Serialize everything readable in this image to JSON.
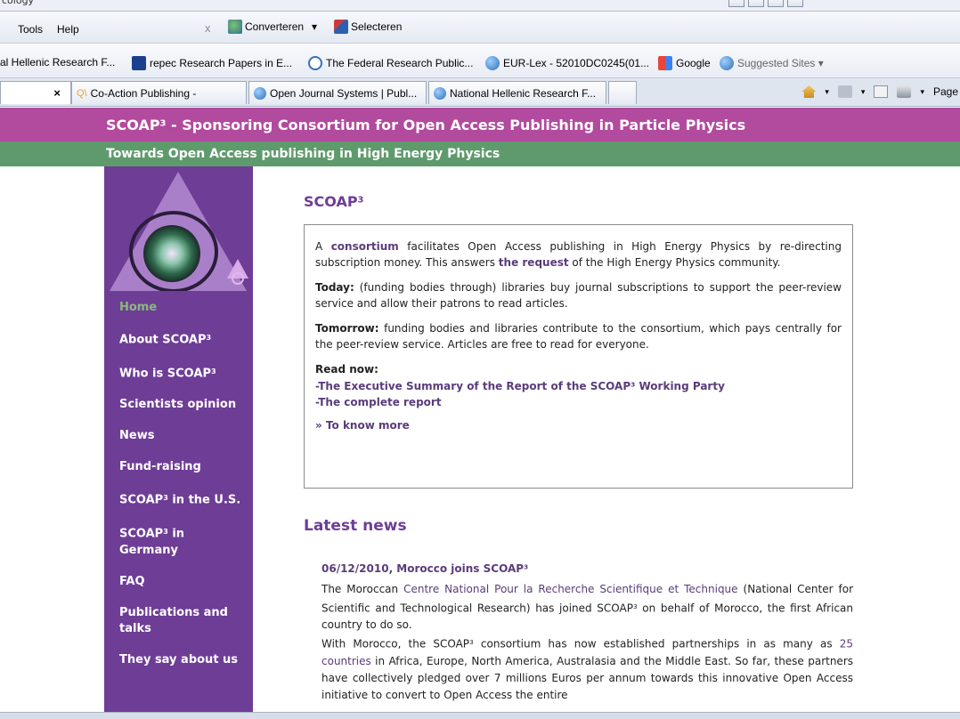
{
  "browser": {
    "window_title": "cology",
    "menu": {
      "tools": "Tools",
      "help": "Help",
      "close_symbol": "x"
    },
    "toolbar": {
      "convert": "Converteren",
      "convert_arrow": "▾",
      "select": "Selecteren"
    },
    "favorites": [
      {
        "label": "al Hellenic Research F..."
      },
      {
        "label": "repec Research Papers in E..."
      },
      {
        "label": "The Federal Research Public..."
      },
      {
        "label": "EUR-Lex - 52010DC0245(01..."
      },
      {
        "label": "Google"
      },
      {
        "label": "Suggested Sites ▾"
      }
    ],
    "tabs": [
      {
        "label": "",
        "close": "×"
      },
      {
        "label": "Co-Action Publishing -"
      },
      {
        "label": "Open Journal Systems | Publ..."
      },
      {
        "label": "National Hellenic Research F..."
      },
      {
        "label": ""
      }
    ],
    "command_bar": {
      "page": "Page"
    }
  },
  "header": {
    "title_a": "SCOAP",
    "title_sup": "3",
    "title_b": " - Sponsoring Consortium for Open Access Publishing in Particle Physics",
    "subtitle": "Towards Open Access publishing in High Energy Physics"
  },
  "nav": {
    "home": "Home",
    "about_a": "About SCOAP",
    "who_a": "Who is SCOAP",
    "sup": "3",
    "scientists": "Scientists opinion",
    "news": "News",
    "fund": "Fund-raising",
    "us_a": "SCOAP",
    "us_b": " in the U.S.",
    "de_a": "SCOAP",
    "de_b": " in Germany",
    "faq": "FAQ",
    "pubs": "Publications and talks",
    "they": "They say about us"
  },
  "main": {
    "heading_a": "SCOAP",
    "heading_sup": "3",
    "intro_1": "A ",
    "intro_link1": "consortium",
    "intro_2": " facilitates Open Access publishing in High Energy Physics by re-directing subscription money. This answers ",
    "intro_link2": "the request",
    "intro_3": " of the High Energy Physics community.",
    "today_label": "Today:",
    "today_text": " (funding bodies through) libraries buy journal subscriptions to support the peer-review service and allow their patrons to read articles.",
    "tomorrow_label": "Tomorrow:",
    "tomorrow_text": " funding bodies and libraries contribute to the consortium, which pays centrally for the peer-review service. Articles are free to read for everyone.",
    "read_now": "Read now:",
    "read_link1_a": "-The Executive Summary of the Report of the SCOAP",
    "read_link1_b": " Working Party",
    "read_link2": "-The complete report",
    "more": "» To know more",
    "latest_news": "Latest news",
    "news_date_a": "06/12/2010, Morocco joins SCOAP",
    "news_1": "The Moroccan ",
    "news_link1": "Centre National Pour la Recherche Scientifique et Technique",
    "news_2": " (National Center for Scientific and Technological Research) has joined SCOAP",
    "news_3": " on behalf of Morocco, the first African country to do so.",
    "news_4": "With Morocco, the SCOAP",
    "news_5": " consortium has now established partnerships in as many as ",
    "news_link2": "25 countries",
    "news_6": " in Africa, Europe, North America, Australasia and the Middle East. So far, these partners have collectively pledged over 7 millions Euros per annum towards this innovative Open Access initiative to convert to Open Access the entire"
  },
  "colors": {
    "header": "#b24a9e",
    "subheader": "#5f9a6c",
    "sidebar": "#6e3d96",
    "home_link": "#8ab87a"
  }
}
